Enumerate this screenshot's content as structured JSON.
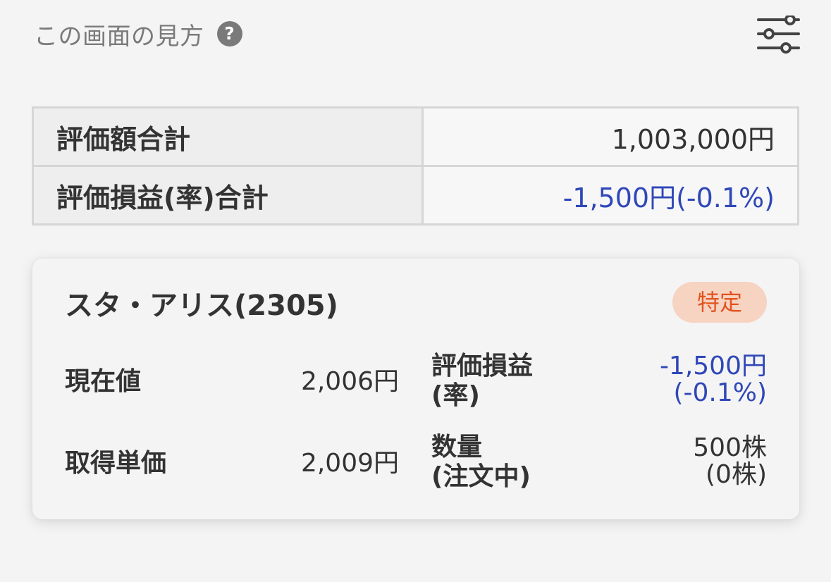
{
  "header": {
    "howto_label": "この画面の見方",
    "help_icon": "question-circle-icon",
    "settings_icon": "sliders-settings-icon"
  },
  "summary": {
    "rows": [
      {
        "label": "評価額合計",
        "value": "1,003,000円"
      },
      {
        "label": "評価損益(率)合計",
        "value": "-1,500円(-0.1%)"
      }
    ]
  },
  "holding": {
    "name": "スタ・アリス(2305)",
    "account_badge": "特定",
    "current_price_label": "現在値",
    "current_price": "2,006円",
    "avg_cost_label": "取得単価",
    "avg_cost": "2,009円",
    "pl_label_line1": "評価損益",
    "pl_label_line2": "(率)",
    "pl_value_line1": "-1,500円",
    "pl_value_line2": "(-0.1%)",
    "qty_label_line1": "数量",
    "qty_label_line2": "(注文中)",
    "qty_value_line1": "500株",
    "qty_value_line2": "(0株)"
  },
  "colors": {
    "negative": "#2f47b8",
    "badge_text": "#e2531e",
    "badge_bg": "#f7d3c2"
  }
}
